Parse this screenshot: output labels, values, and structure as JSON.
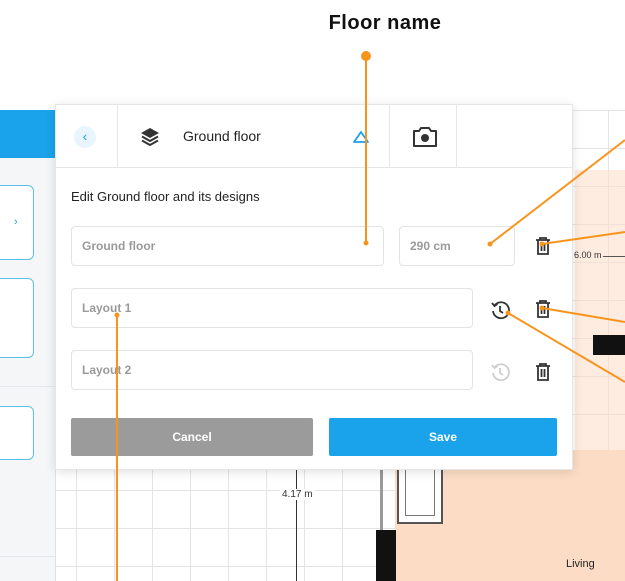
{
  "annotation": {
    "title": "Floor name"
  },
  "dialog": {
    "floor_title": "Ground floor",
    "heading": "Edit Ground floor and its designs",
    "floor_name_value": "Ground floor",
    "height_value": "290 cm",
    "layouts": [
      {
        "name": "Layout 1",
        "restore_active": true
      },
      {
        "name": "Layout 2",
        "restore_active": false
      }
    ],
    "cancel_label": "Cancel",
    "save_label": "Save"
  },
  "plan": {
    "dimension_vertical": "4.17 m",
    "dimension_right": "6.00 m",
    "room_label": "Living"
  },
  "colors": {
    "accent": "#1aa3ea",
    "annotation": "#f7941d",
    "cancel": "#9b9b9b",
    "room_fill": "#fcdcc4"
  },
  "icons": [
    "back-chevron-icon",
    "layers-icon",
    "triangle-icon",
    "camera-icon",
    "trash-icon",
    "restore-history-icon"
  ]
}
